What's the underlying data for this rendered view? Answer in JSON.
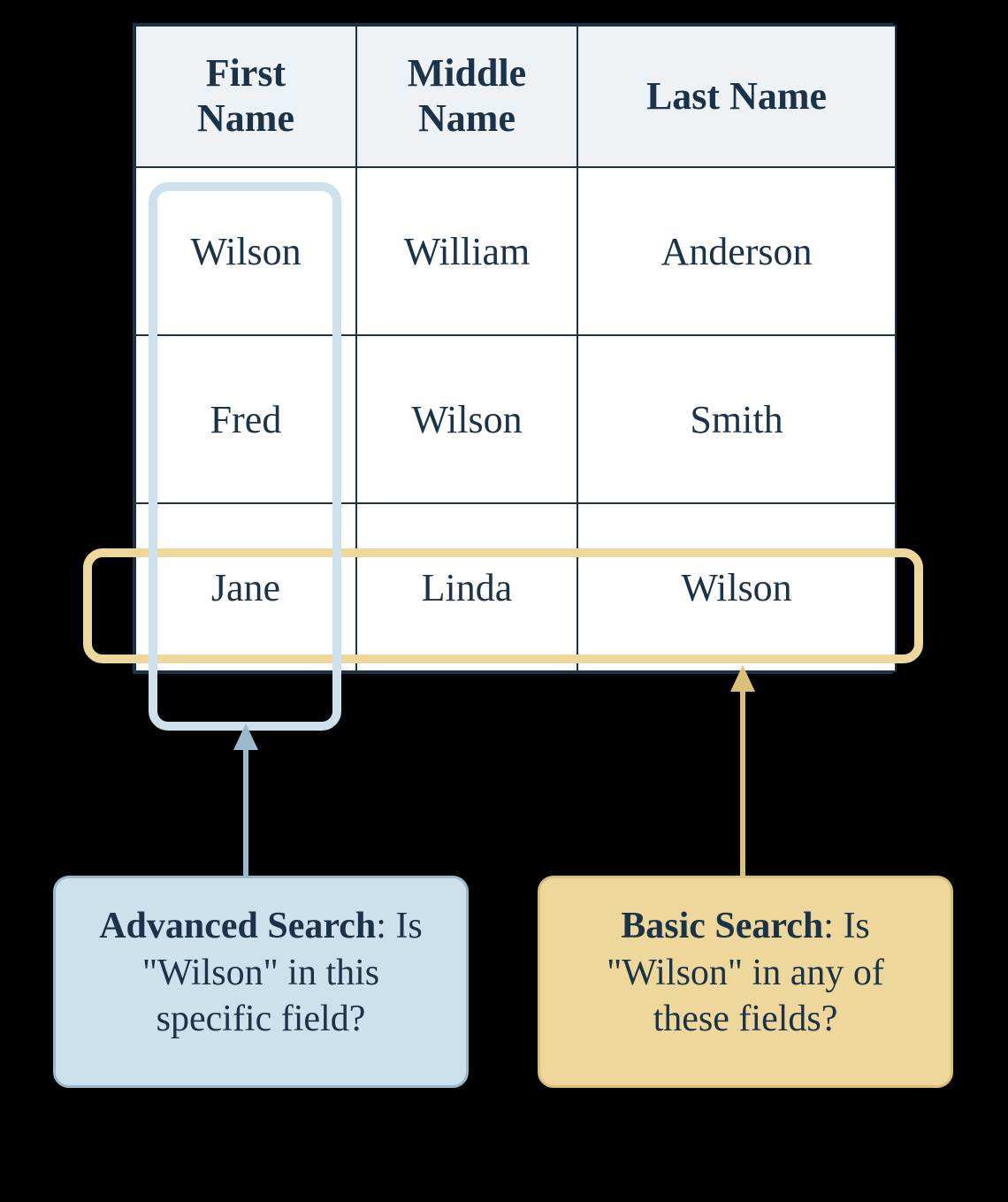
{
  "table": {
    "headers": [
      "First\nName",
      "Middle\nName",
      "Last Name"
    ],
    "rows": [
      [
        "Wilson",
        "William",
        "Anderson"
      ],
      [
        "Fred",
        "Wilson",
        "Smith"
      ],
      [
        "Jane",
        "Linda",
        "Wilson"
      ]
    ]
  },
  "callouts": {
    "advanced": {
      "title": "Advanced Search",
      "body": ": Is \"Wilson\" in this specific field?"
    },
    "basic": {
      "title": "Basic Search",
      "body": ": Is \"Wilson\" in any of these fields?"
    }
  },
  "colors": {
    "ink": "#1b3349",
    "headerBg": "#eef2f5",
    "blue": "#cde1ec",
    "blueBorder": "#9bb9cc",
    "yellow": "#eed79b",
    "yellowBorder": "#d9bf78"
  }
}
